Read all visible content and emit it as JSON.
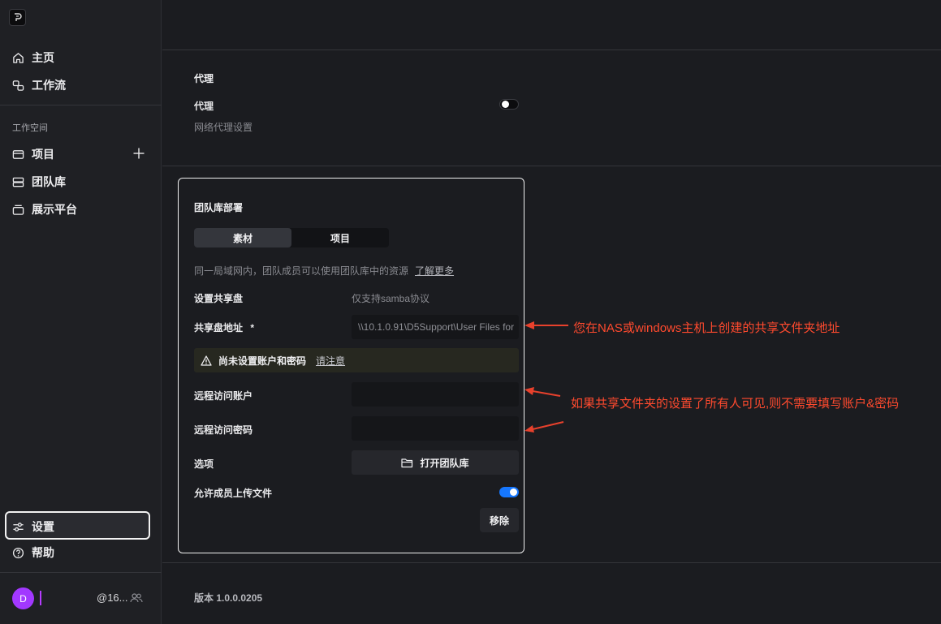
{
  "sidebar": {
    "nav": [
      {
        "label": "主页",
        "icon": "home-icon"
      },
      {
        "label": "工作流",
        "icon": "workflow-icon"
      }
    ],
    "workspace_title": "工作空间",
    "workspace_items": [
      {
        "label": "项目",
        "icon": "project-icon"
      },
      {
        "label": "团队库",
        "icon": "team-library-icon"
      },
      {
        "label": "展示平台",
        "icon": "showcase-icon"
      }
    ],
    "bottom": [
      {
        "label": "设置",
        "icon": "settings-icon"
      },
      {
        "label": "帮助",
        "icon": "help-icon"
      }
    ],
    "user": {
      "avatar_letter": "D",
      "name": "@16..."
    }
  },
  "proxy": {
    "section_title": "代理",
    "label": "代理",
    "description": "网络代理设置",
    "enabled": false
  },
  "team_library": {
    "title": "团队库部署",
    "tabs": [
      {
        "label": "素材",
        "active": true
      },
      {
        "label": "项目",
        "active": false
      }
    ],
    "hint": "同一局域网内，团队成员可以使用团队库中的资源",
    "hint_link": "了解更多",
    "share_label": "设置共享盘",
    "share_note": "仅支持samba协议",
    "address_label": "共享盘地址",
    "address_required": "*",
    "address_value": "\\\\10.1.0.91\\D5Support\\User Files for",
    "warning_text": "尚未设置账户和密码",
    "warning_link": "请注意",
    "account_label": "远程访问账户",
    "account_value": "",
    "password_label": "远程访问密码",
    "password_value": "",
    "options_label": "选项",
    "open_button": "打开团队库",
    "upload_label": "允许成员上传文件",
    "upload_enabled": true,
    "remove_button": "移除"
  },
  "version": "版本 1.0.0.0205",
  "annotations": [
    "您在NAS或windows主机上创建的共享文件夹地址",
    "如果共享文件夹的设置了所有人可见,则不需要填写账户&密码"
  ],
  "colors": {
    "accent": "#1677ff",
    "annotation": "#ff4a2e",
    "avatar": "#a238ff"
  }
}
